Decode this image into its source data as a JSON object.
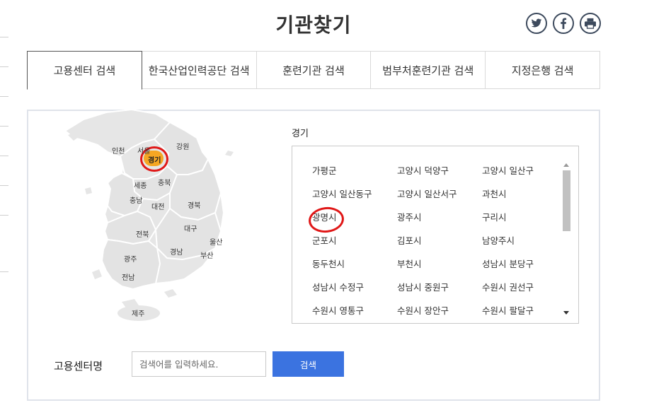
{
  "page": {
    "title": "기관찾기"
  },
  "share": {
    "twitter": "twitter-icon",
    "facebook": "facebook-icon",
    "print": "print-icon",
    "icon_color": "#3d4a5d"
  },
  "tabs": [
    {
      "label": "고용센터 검색",
      "active": true
    },
    {
      "label": "한국산업인력공단 검색",
      "active": false
    },
    {
      "label": "훈련기관 검색",
      "active": false
    },
    {
      "label": "범부처훈련기관 검색",
      "active": false
    },
    {
      "label": "지정은행 검색",
      "active": false
    }
  ],
  "map": {
    "regions": [
      "인천",
      "서울",
      "경기",
      "강원",
      "세종",
      "충북",
      "충남",
      "대전",
      "경북",
      "대구",
      "전북",
      "울산",
      "광주",
      "경남",
      "부산",
      "전남",
      "제주"
    ],
    "selected": "경기",
    "selected_color": "#f5a623",
    "annotation_color": "#e01818"
  },
  "region_title": "경기",
  "list": {
    "items": [
      "가평군",
      "고양시 덕양구",
      "고양시 일산구",
      "고양시 일산동구",
      "고양시 일산서구",
      "과천시",
      "광명시",
      "광주시",
      "구리시",
      "군포시",
      "김포시",
      "남양주시",
      "동두천시",
      "부천시",
      "성남시 분당구",
      "성남시 수정구",
      "성남시 중원구",
      "수원시 권선구",
      "수원시 영통구",
      "수원시 장안구",
      "수원시 팔달구"
    ],
    "circled": "광명시"
  },
  "search": {
    "label": "고용센터명",
    "placeholder": "검색어를 입력하세요.",
    "button": "검색",
    "button_color": "#3b73e0"
  }
}
